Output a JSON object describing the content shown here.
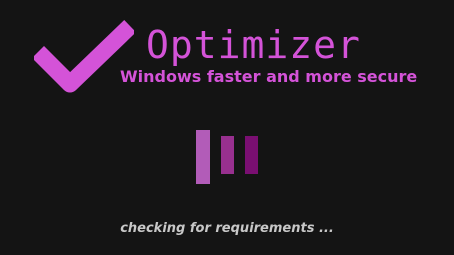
{
  "app": {
    "title": "Optimizer",
    "subtitle": "Windows faster and more secure"
  },
  "logo": {
    "icon": "checkmark-icon",
    "color": "#d453d8"
  },
  "loader": {
    "icon": "loading-bars-icon",
    "bar_colors": [
      "#b25cb8",
      "#98308f",
      "#7a0f72"
    ]
  },
  "status": {
    "text": "checking for requirements ..."
  },
  "colors": {
    "background": "#141414",
    "accent": "#d453d8",
    "status_text": "#c8c8c8"
  }
}
